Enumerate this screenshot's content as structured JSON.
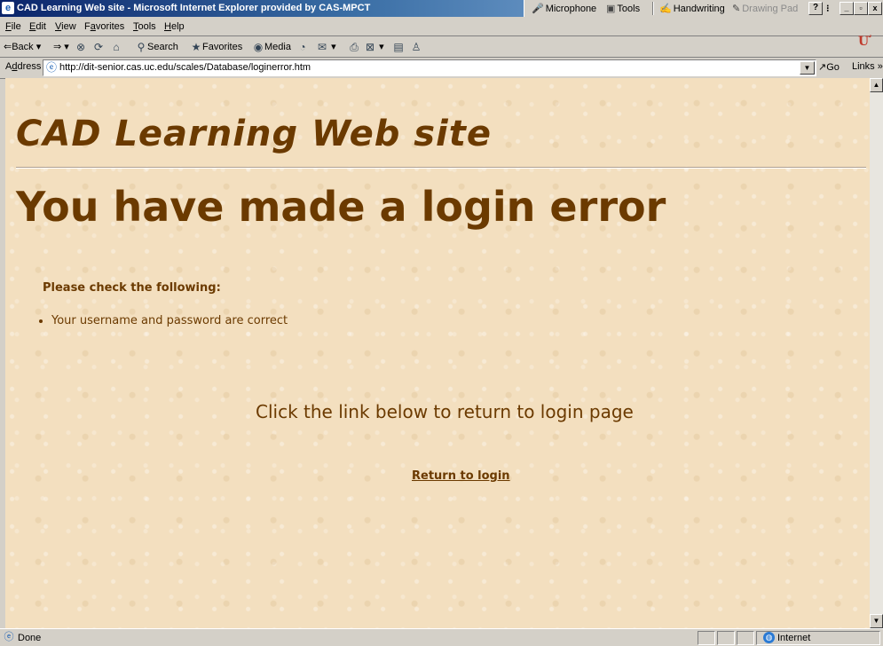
{
  "window": {
    "title": "CAD Learning Web site - Microsoft Internet Explorer provided by CAS-MPCT",
    "app_icon": "e",
    "language_bar": {
      "microphone": "Microphone",
      "tools": "Tools",
      "handwriting": "Handwriting",
      "drawing_pad": "Drawing Pad",
      "help": "?"
    },
    "controls": {
      "minimize": "_",
      "restore": "▫",
      "close": "x"
    }
  },
  "menu": {
    "items": [
      {
        "accel": "F",
        "rest": "ile"
      },
      {
        "accel": "E",
        "rest": "dit"
      },
      {
        "accel": "V",
        "rest": "iew"
      },
      {
        "pre": "F",
        "accel": "a",
        "rest": "vorites"
      },
      {
        "accel": "T",
        "rest": "ools"
      },
      {
        "accel": "H",
        "rest": "elp"
      }
    ],
    "brand_logo": "Ư"
  },
  "toolbar": {
    "back": "Back",
    "search": "Search",
    "favorites": "Favorites",
    "media": "Media"
  },
  "address": {
    "label_accel": "d",
    "label_pre": "A",
    "label_rest": "dress",
    "url": "http://dit-senior.cas.uc.edu/scales/Database/loginerror.htm",
    "go": "Go",
    "links": "Links"
  },
  "page": {
    "site_title": "CAD Learning Web site",
    "heading": "You have made a login error",
    "check_label": "Please check the following:",
    "bullets": [
      "Your username and password are correct"
    ],
    "return_hint": "Click the link below to return to login page",
    "return_link": "Return to login",
    "colors": {
      "text": "#6b3a00",
      "background": "#f3dfbf"
    }
  },
  "status": {
    "text": "Done",
    "zone": "Internet"
  }
}
